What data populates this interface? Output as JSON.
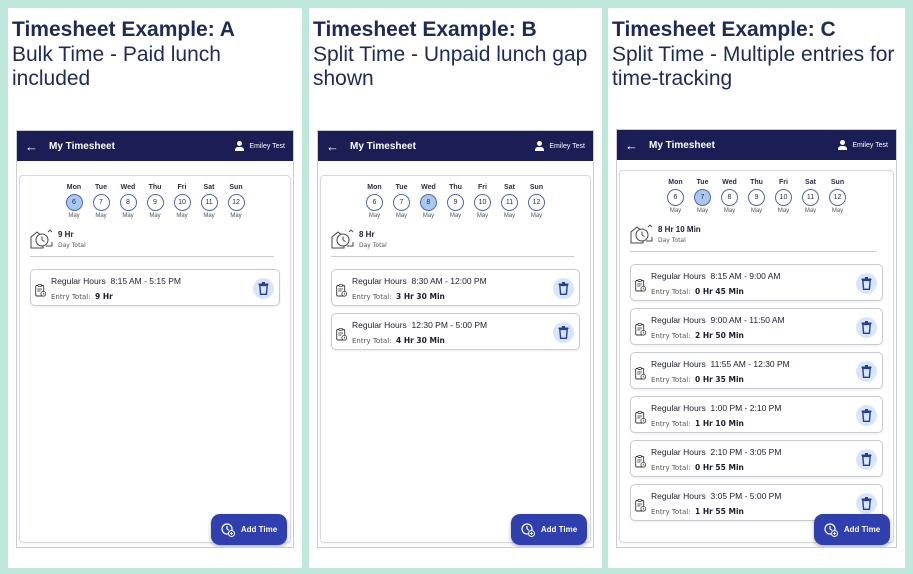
{
  "panels": [
    {
      "title": "Timesheet Example: A",
      "subtitle": "Bulk Time - Paid lunch included",
      "app_title": "My Timesheet",
      "user_name": "Emiley Test",
      "days": [
        {
          "name": "Mon",
          "num": "6",
          "month": "May",
          "selected": true
        },
        {
          "name": "Tue",
          "num": "7",
          "month": "May",
          "selected": false
        },
        {
          "name": "Wed",
          "num": "8",
          "month": "May",
          "selected": false
        },
        {
          "name": "Thu",
          "num": "9",
          "month": "May",
          "selected": false
        },
        {
          "name": "Fri",
          "num": "10",
          "month": "May",
          "selected": false
        },
        {
          "name": "Sat",
          "num": "11",
          "month": "May",
          "selected": false
        },
        {
          "name": "Sun",
          "num": "12",
          "month": "May",
          "selected": false
        }
      ],
      "total_value": "9 Hr",
      "total_label": "Day Total",
      "entries": [
        {
          "type": "Regular Hours",
          "range": "8:15 AM - 5:15 PM",
          "total_label": "Entry Total:",
          "total": "9 Hr"
        }
      ],
      "add_label": "Add Time"
    },
    {
      "title": "Timesheet Example: B",
      "subtitle": "Split Time - Unpaid lunch gap shown",
      "app_title": "My Timesheet",
      "user_name": "Emiley Test",
      "days": [
        {
          "name": "Mon",
          "num": "6",
          "month": "May",
          "selected": false
        },
        {
          "name": "Tue",
          "num": "7",
          "month": "May",
          "selected": false
        },
        {
          "name": "Wed",
          "num": "8",
          "month": "May",
          "selected": true
        },
        {
          "name": "Thu",
          "num": "9",
          "month": "May",
          "selected": false
        },
        {
          "name": "Fri",
          "num": "10",
          "month": "May",
          "selected": false
        },
        {
          "name": "Sat",
          "num": "11",
          "month": "May",
          "selected": false
        },
        {
          "name": "Sun",
          "num": "12",
          "month": "May",
          "selected": false
        }
      ],
      "total_value": "8 Hr",
      "total_label": "Day Total",
      "entries": [
        {
          "type": "Regular Hours",
          "range": "8:30 AM - 12:00 PM",
          "total_label": "Entry Total:",
          "total": "3 Hr 30 Min"
        },
        {
          "type": "Regular Hours",
          "range": "12:30 PM - 5:00 PM",
          "total_label": "Entry Total:",
          "total": "4 Hr 30 Min"
        }
      ],
      "add_label": "Add Time"
    },
    {
      "title": "Timesheet Example: C",
      "subtitle": "Split Time - Multiple entries for time-tracking",
      "app_title": "My Timesheet",
      "user_name": "Emiley Test",
      "days": [
        {
          "name": "Mon",
          "num": "6",
          "month": "May",
          "selected": false
        },
        {
          "name": "Tue",
          "num": "7",
          "month": "May",
          "selected": true
        },
        {
          "name": "Wed",
          "num": "8",
          "month": "May",
          "selected": false
        },
        {
          "name": "Thu",
          "num": "9",
          "month": "May",
          "selected": false
        },
        {
          "name": "Fri",
          "num": "10",
          "month": "May",
          "selected": false
        },
        {
          "name": "Sat",
          "num": "11",
          "month": "May",
          "selected": false
        },
        {
          "name": "Sun",
          "num": "12",
          "month": "May",
          "selected": false
        }
      ],
      "total_value": "8 Hr 10 Min",
      "total_label": "Day Total",
      "entries": [
        {
          "type": "Regular Hours",
          "range": "8:15 AM - 9:00 AM",
          "total_label": "Entry Total:",
          "total": "0 Hr 45 Min"
        },
        {
          "type": "Regular Hours",
          "range": "9:00 AM - 11:50 AM",
          "total_label": "Entry Total:",
          "total": "2 Hr 50 Min"
        },
        {
          "type": "Regular Hours",
          "range": "11:55 AM - 12:30 PM",
          "total_label": "Entry Total:",
          "total": "0 Hr 35 Min"
        },
        {
          "type": "Regular Hours",
          "range": "1:00 PM - 2:10 PM",
          "total_label": "Entry Total:",
          "total": "1 Hr 10 Min"
        },
        {
          "type": "Regular Hours",
          "range": "2:10 PM - 3:05 PM",
          "total_label": "Entry Total:",
          "total": "0 Hr 55 Min"
        },
        {
          "type": "Regular Hours",
          "range": "3:05 PM - 5:00 PM",
          "total_label": "Entry Total:",
          "total": "1 Hr 55 Min"
        }
      ],
      "add_label": "Add Time"
    }
  ],
  "colors": {
    "background": "#bfe8dc",
    "app_bar": "#1b1d55",
    "title_text": "#1e2a57",
    "selected_day": "#a9c8f0",
    "delete_bg": "#d6e6fb",
    "fab": "#2f3fae"
  }
}
